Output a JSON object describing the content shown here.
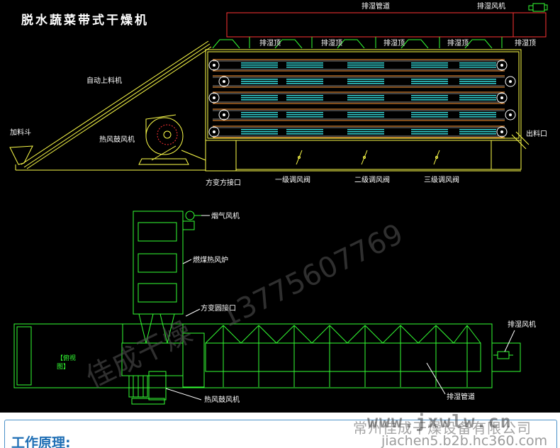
{
  "title": "脱水蔬菜带式干燥机",
  "labels": {
    "exhaust_pipe_top": "排湿管道",
    "exhaust_fan_top": "排湿风机",
    "exhaust_tops": [
      "排湿顶",
      "排湿顶",
      "排湿顶",
      "排湿顶",
      "排湿顶"
    ],
    "auto_feeder": "自动上料机",
    "feed_hopper": "加料斗",
    "hot_air_blower": "热风鼓风机",
    "discharge": "出料口",
    "square_to_square": "方变方接口",
    "damper_1": "一级调风阀",
    "damper_2": "二级调风阀",
    "damper_3": "三级调风阀",
    "smoke_fan": "烟气风机",
    "coal_furnace": "燃煤热风炉",
    "square_to_round": "方变圆接口",
    "exhaust_fan_right": "排湿风机",
    "plan_view_line1": "【俯视",
    "plan_view_line2": "图】",
    "exhaust_pipe_bottom": "排湿管道",
    "hot_air_blower_bottom": "热风鼓风机"
  },
  "watermark": {
    "brand": "佳成干燥",
    "phone": "13775607769",
    "url": "www.jxwlw.cn",
    "company": "常州佳成干燥设备有限公司",
    "domain": "jiachen5.b2b.hc360.com"
  },
  "panel": {
    "title": "工作原理:"
  },
  "colors": {
    "background": "#000000",
    "frame": "#ffff4a",
    "lines_green": "#33ff33",
    "belts": "#ff9933",
    "trays": "#33cccc",
    "pipe": "#ff3333",
    "text": "#ffffff",
    "plan_view_label": "#33ff33",
    "panel_title": "#1f6fb5"
  }
}
